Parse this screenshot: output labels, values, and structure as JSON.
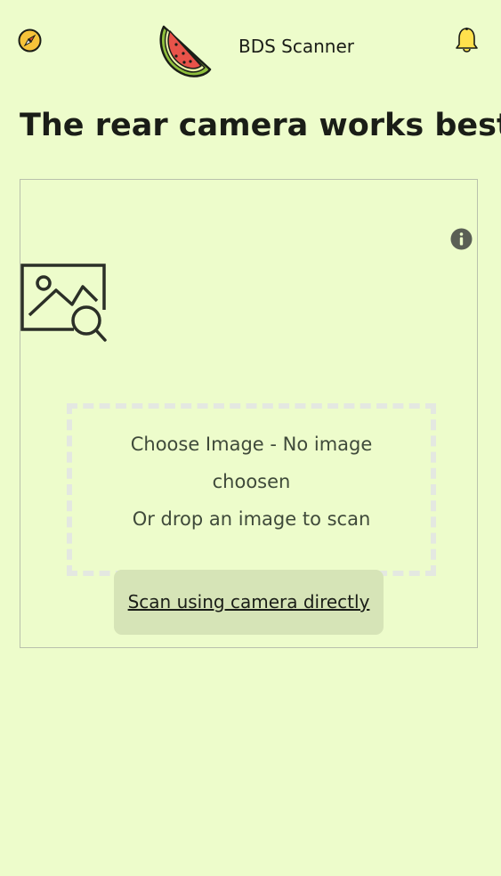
{
  "header": {
    "app_title": "BDS Scanner",
    "compass_icon": "compass-icon",
    "logo_icon": "watermelon-logo",
    "bell_icon": "bell-icon"
  },
  "page": {
    "title": "The rear camera works best!"
  },
  "scanner": {
    "info_icon": "info-icon",
    "image_icon": "image-search-icon",
    "drop_zone": {
      "line1": "Choose Image - No image",
      "line2": "choosen",
      "line3": "Or drop an image to scan"
    },
    "camera_button_label": "Scan using camera directly"
  },
  "colors": {
    "background": "#edfccb",
    "button": "#d6e4b7",
    "text": "#1a1d17",
    "dashed_border": "#e4e8e1"
  }
}
